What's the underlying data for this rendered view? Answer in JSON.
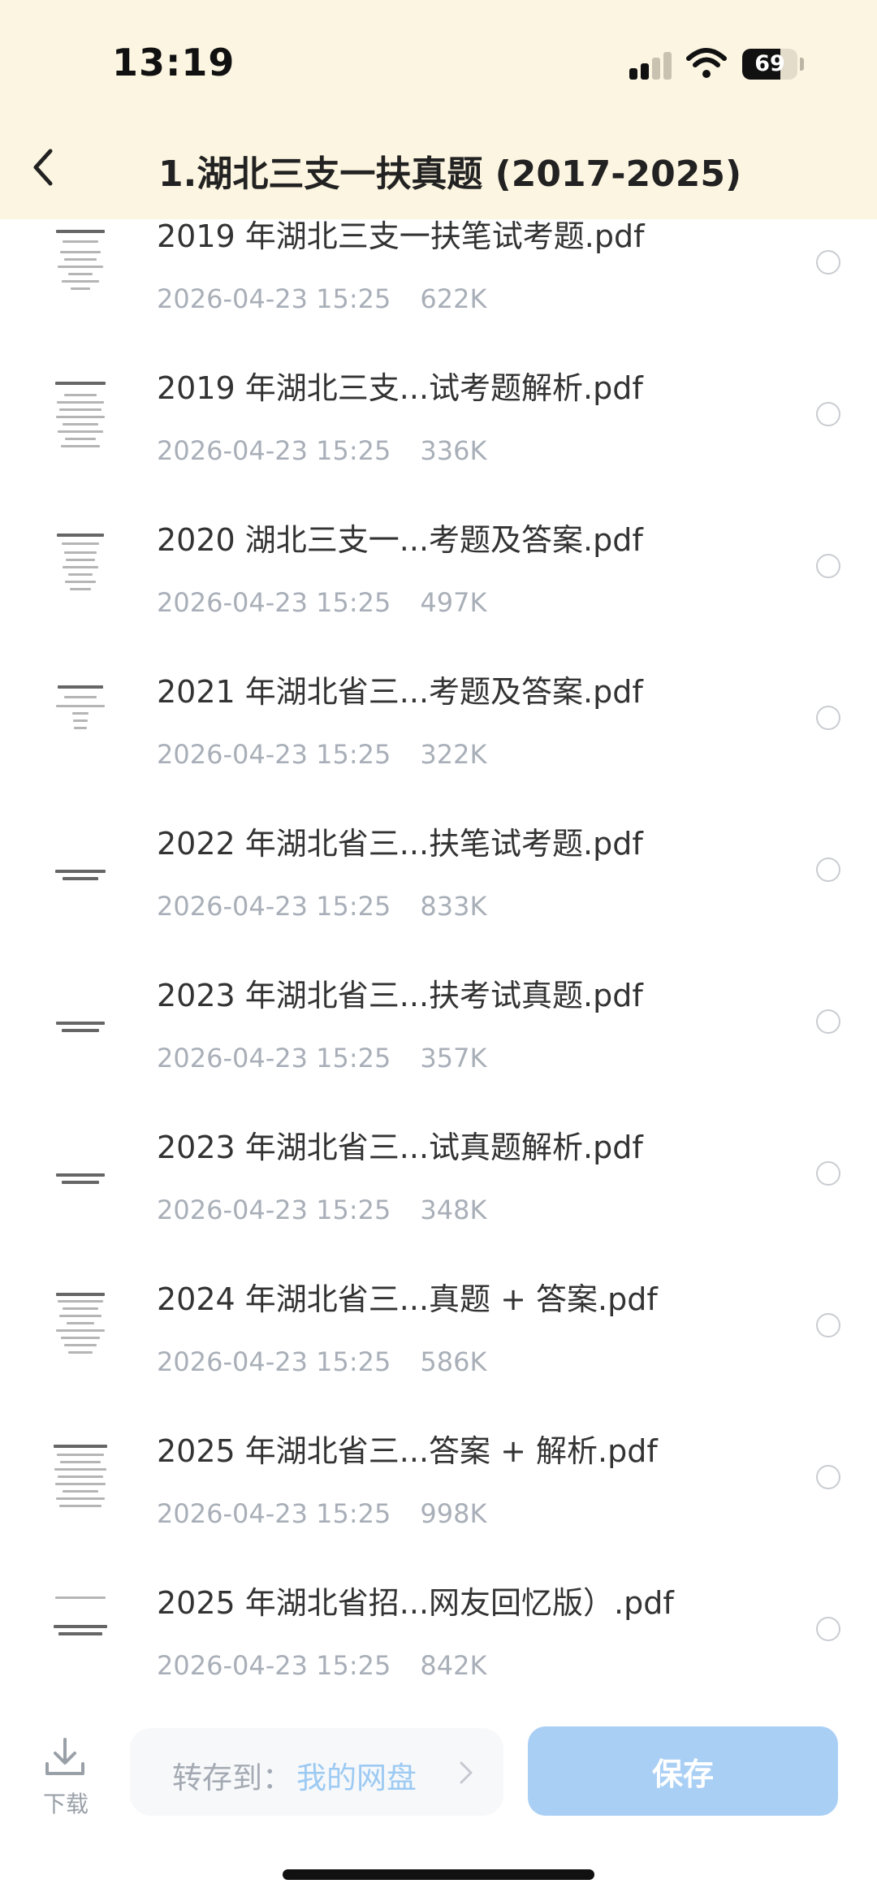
{
  "status_bar": {
    "time": "13:19",
    "battery": "69",
    "battery_level": 0.69
  },
  "header": {
    "title": "1.湖北三支一扶真题 (2017-2025)"
  },
  "files": [
    {
      "name": "2019 年湖北三支一扶笔试考题.pdf",
      "date": "2026-04-23 15:25",
      "size": "622K"
    },
    {
      "name": "2019 年湖北三支...试考题解析.pdf",
      "date": "2026-04-23 15:25",
      "size": "336K"
    },
    {
      "name": "2020 湖北三支一...考题及答案.pdf",
      "date": "2026-04-23 15:25",
      "size": "497K"
    },
    {
      "name": "2021 年湖北省三...考题及答案.pdf",
      "date": "2026-04-23 15:25",
      "size": "322K"
    },
    {
      "name": "2022 年湖北省三...扶笔试考题.pdf",
      "date": "2026-04-23 15:25",
      "size": "833K"
    },
    {
      "name": "2023 年湖北省三...扶考试真题.pdf",
      "date": "2026-04-23 15:25",
      "size": "357K"
    },
    {
      "name": "2023 年湖北省三...试真题解析.pdf",
      "date": "2026-04-23 15:25",
      "size": "348K"
    },
    {
      "name": "2024 年湖北省三...真题 + 答案.pdf",
      "date": "2026-04-23 15:25",
      "size": "586K"
    },
    {
      "name": "2025 年湖北省三...答案 + 解析.pdf",
      "date": "2026-04-23 15:25",
      "size": "998K"
    },
    {
      "name": "2025 年湖北省招...网友回忆版）.pdf",
      "date": "2026-04-23 15:25",
      "size": "842K"
    }
  ],
  "footer": {
    "download_label": "下载",
    "save_to_label": "转存到：",
    "save_to_target": "我的网盘",
    "save_button": "保存"
  },
  "colors": {
    "header_bg": "#fcf5e1",
    "save_button_bg": "#a9cff5",
    "target_link": "#9ccaf3",
    "meta_text": "#a9afb8"
  },
  "icons": {
    "back": "chevron-left-icon",
    "download": "download-icon",
    "chevron": "chevron-right-icon",
    "file_thumb": "pdf-thumbnail-icon",
    "radio": "radio-unselected-icon"
  }
}
